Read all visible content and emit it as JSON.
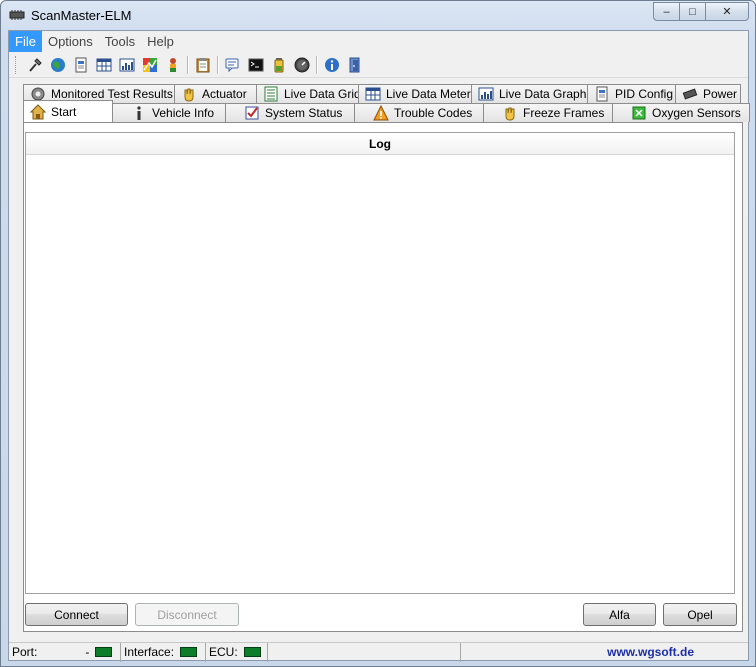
{
  "window": {
    "title": "ScanMaster-ELM",
    "controls": {
      "minimize": "‒",
      "maximize": "□",
      "close": "✕"
    }
  },
  "menu": [
    "File",
    "Options",
    "Tools",
    "Help"
  ],
  "toolbar_icons": [
    "connect-plug-icon",
    "globe-icon",
    "document-icon",
    "grid-icon",
    "meter-icon",
    "color-graph-icon",
    "person-icon",
    "clipboard-icon",
    "chat-icon",
    "terminal-icon",
    "battery-icon",
    "gauge-icon",
    "info-icon",
    "door-icon"
  ],
  "tabs_back": [
    {
      "label": "Monitored Test Results",
      "icon": "gear-icon"
    },
    {
      "label": "Actuator",
      "icon": "hand-icon"
    },
    {
      "label": "Live Data Grid",
      "icon": "list-icon"
    },
    {
      "label": "Live Data Meter",
      "icon": "grid-icon"
    },
    {
      "label": "Live Data Graph",
      "icon": "graph-icon"
    },
    {
      "label": "PID Config",
      "icon": "page-icon"
    },
    {
      "label": "Power",
      "icon": "chip-icon"
    }
  ],
  "tabs_front": [
    {
      "label": "Start",
      "icon": "house-icon",
      "selected": true
    },
    {
      "label": "Vehicle Info",
      "icon": "info-icon"
    },
    {
      "label": "System Status",
      "icon": "checkbox-icon"
    },
    {
      "label": "Trouble Codes",
      "icon": "warning-icon"
    },
    {
      "label": "Freeze Frames",
      "icon": "hand-icon"
    },
    {
      "label": "Oxygen Sensors",
      "icon": "sensor-icon"
    }
  ],
  "log": {
    "title": "Log"
  },
  "buttons": {
    "connect": "Connect",
    "disconnect": "Disconnect",
    "alfa": "Alfa",
    "opel": "Opel"
  },
  "status": {
    "port_label": "Port:",
    "port_value": "-",
    "interface_label": "Interface:",
    "ecu_label": "ECU:",
    "website": "www.wgsoft.de"
  },
  "colors": {
    "led": "#0d7d2a",
    "menu_active": "#3399ff",
    "link": "#1d2fa8"
  }
}
